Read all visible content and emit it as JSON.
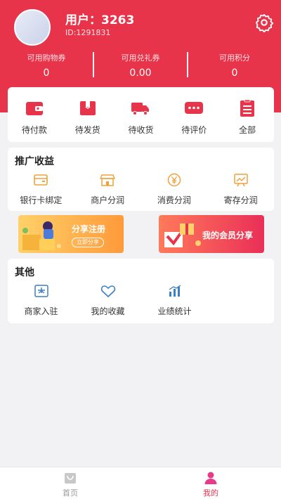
{
  "colors": {
    "brand": "#e8344a",
    "icon_red": "#e8344a",
    "icon_blue": "#3a7fc4",
    "tab_active": "#e8344a",
    "tab_inactive": "#999999"
  },
  "profile": {
    "name": "用户：3263",
    "id": "ID:1291831"
  },
  "stats": [
    {
      "label": "可用购物券",
      "value": "0"
    },
    {
      "label": "可用兑礼券",
      "value": "0.00"
    },
    {
      "label": "可用积分",
      "value": "0"
    }
  ],
  "orders": [
    {
      "label": "待付款",
      "icon": "wallet-icon"
    },
    {
      "label": "待发货",
      "icon": "gift-box-icon"
    },
    {
      "label": "待收货",
      "icon": "truck-icon"
    },
    {
      "label": "待评价",
      "icon": "chat-bubble-icon"
    },
    {
      "label": "全部",
      "icon": "list-icon"
    }
  ],
  "promo": {
    "title": "推广收益",
    "items": [
      {
        "label": "银行卡绑定",
        "icon": "bank-card-icon"
      },
      {
        "label": "商户分润",
        "icon": "shop-icon"
      },
      {
        "label": "消费分润",
        "icon": "yuan-coin-icon"
      },
      {
        "label": "寄存分润",
        "icon": "chart-board-icon"
      }
    ]
  },
  "banners": {
    "share": {
      "title": "分享注册",
      "button": "立即分享"
    },
    "member": {
      "title": "我的会员分享"
    }
  },
  "other": {
    "title": "其他",
    "items": [
      {
        "label": "商家入驻",
        "icon": "store-entry-icon"
      },
      {
        "label": "我的收藏",
        "icon": "heart-icon"
      },
      {
        "label": "业绩统计",
        "icon": "bar-chart-icon"
      }
    ]
  },
  "tabs": [
    {
      "label": "首页",
      "icon": "shopping-bag-icon",
      "active": false
    },
    {
      "label": "我的",
      "icon": "user-icon",
      "active": true
    }
  ]
}
